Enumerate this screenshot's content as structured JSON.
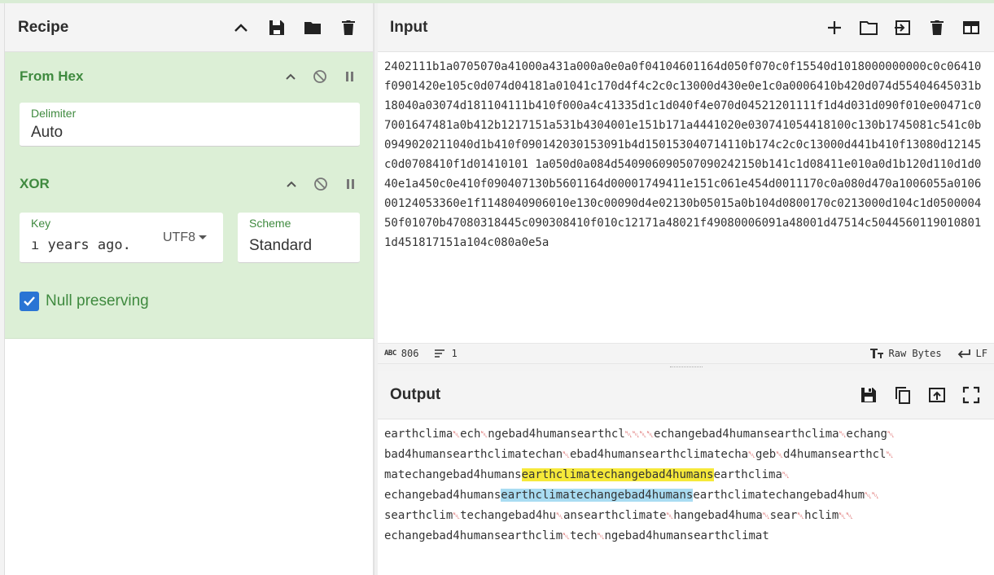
{
  "recipe": {
    "title": "Recipe"
  },
  "from_hex": {
    "title": "From Hex",
    "delimiter_label": "Delimiter",
    "delimiter_value": "Auto"
  },
  "xor": {
    "title": "XOR",
    "key_label": "Key",
    "key_value": "ı years ago.",
    "key_encoding": "UTF8",
    "scheme_label": "Scheme",
    "scheme_value": "Standard",
    "null_preserving_label": "Null preserving",
    "null_preserving_checked": true
  },
  "input": {
    "title": "Input",
    "text": "2402111b1a0705070a41000a431a000a0e0a0f04104601164d050f070c0f15540d1018000000000c0c06410f0901420e105c0d074d04181a01041c170d4f4c2c0c13000d430e0e1c0a0006410b420d074d55404645031b18040a03074d181104111b410f000a4c41335d1c1d040f4e070d04521201111f1d4d031d090f010e00471c07001647481a0b412b1217151a531b4304001e151b171a4441020e030741054418100c130b1745081c541c0b0949020211040d1b410f090142030153091b4d150153040714110b174c2c0c13000d441b410f13080d12145c0d0708410f1d01410101 1a050d0a084d540906090507090242150b141c1d08411e010a0d1b120d110d1d040e1a450c0e410f090407130b5601164d00001749411e151c061e454d0011170c0a080d470a1006055a010600124053360e1f1148040906010e130c00090d4e02130b05015a0b104d0800170c0213000d104c1d050000450f01070b47080318445c090308410f010c12171a48021f49080006091a48001d47514c50445601190108011d451817151a104c080a0e5a",
    "char_count": "806",
    "line_count": "1",
    "encoding": "Raw Bytes",
    "eol": "LF"
  },
  "output": {
    "title": "Output",
    "lines": [
      [
        {
          "t": "earthclima"
        },
        {
          "t": "␀",
          "c": 1
        },
        {
          "t": "ech"
        },
        {
          "t": "␀",
          "c": 1
        },
        {
          "t": "ngebad4humansearthcl"
        },
        {
          "t": "␀␀␀␀",
          "c": 1
        },
        {
          "t": "echangebad4humansearthclima"
        },
        {
          "t": "␀",
          "c": 1
        },
        {
          "t": "echang"
        },
        {
          "t": "␀",
          "c": 1
        }
      ],
      [
        {
          "t": "bad4humansearthclimatechan"
        },
        {
          "t": "␀",
          "c": 1
        },
        {
          "t": "ebad4humansearthclimatecha"
        },
        {
          "t": "␀",
          "c": 1
        },
        {
          "t": "geb"
        },
        {
          "t": "␀",
          "c": 1
        },
        {
          "t": "d4humansearthcl"
        },
        {
          "t": "␀",
          "c": 1
        }
      ],
      [
        {
          "t": "matechangebad4humans"
        },
        {
          "t": "earthclimatechangebad4humans",
          "h": "y"
        },
        {
          "t": "earthclima"
        },
        {
          "t": "␀",
          "c": 1
        }
      ],
      [
        {
          "t": "echangebad4humans"
        },
        {
          "t": "earthclimatechangebad4humans",
          "h": "b"
        },
        {
          "t": "earthclimatechangebad4hum"
        },
        {
          "t": "␀␀",
          "c": 1
        }
      ],
      [
        {
          "t": "searthclim"
        },
        {
          "t": "␀",
          "c": 1
        },
        {
          "t": "techangebad4hu"
        },
        {
          "t": "␀",
          "c": 1
        },
        {
          "t": "ansearthclimate"
        },
        {
          "t": "␀",
          "c": 1
        },
        {
          "t": "hangebad4huma"
        },
        {
          "t": "␀",
          "c": 1
        },
        {
          "t": "sear"
        },
        {
          "t": "␀",
          "c": 1
        },
        {
          "t": "hclim"
        },
        {
          "t": "␀␀",
          "c": 1
        }
      ],
      [
        {
          "t": "echangebad4humansearthclim"
        },
        {
          "t": "␀",
          "c": 1
        },
        {
          "t": "tech"
        },
        {
          "t": "␀",
          "c": 1
        },
        {
          "t": "ngebad4humansearthclimat"
        }
      ]
    ]
  }
}
